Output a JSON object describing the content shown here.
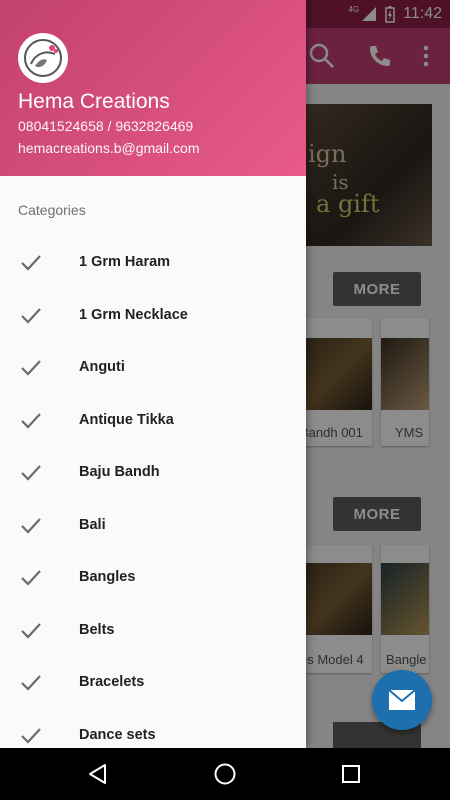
{
  "status_bar": {
    "network": "4G",
    "time": "11:42"
  },
  "background": {
    "banner_text": [
      "ign",
      "is",
      "a gift"
    ],
    "more_label": "MORE",
    "products_row1": [
      "Bandh 001",
      "YMS"
    ],
    "products_row2": [
      "es Model 4",
      "Bangle"
    ]
  },
  "drawer": {
    "brand_name": "Hema Creations",
    "phone": "08041524658 / 9632826469",
    "email": "hemacreations.b@gmail.com",
    "section_title": "Categories",
    "categories": [
      "1 Grm Haram",
      "1 Grm Necklace",
      "Anguti",
      "Antique Tikka",
      "Baju Bandh",
      "Bali",
      "Bangles",
      "Belts",
      "Bracelets",
      "Dance sets"
    ]
  },
  "colors": {
    "accent": "#c43f74",
    "header_start": "#c2416f",
    "header_end": "#e85a8a",
    "fab": "#1e6fae"
  }
}
